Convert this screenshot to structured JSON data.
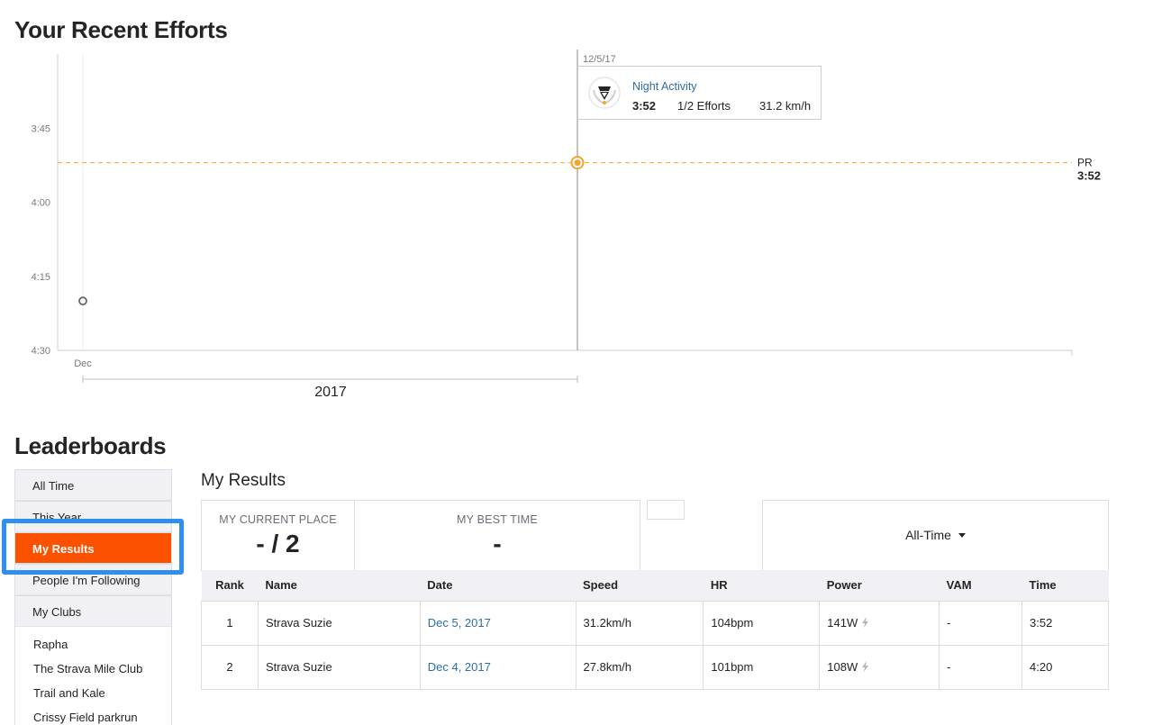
{
  "page": {
    "efforts_heading": "Your Recent Efforts",
    "leaderboards_heading": "Leaderboards"
  },
  "chart_data": {
    "type": "scatter",
    "y_axis": {
      "ticks": [
        "3:45",
        "4:00",
        "4:15",
        "4:30"
      ],
      "range_seconds": [
        210,
        270
      ],
      "reversed": true
    },
    "x_axis": {
      "tick_labels": [
        "Dec"
      ],
      "group_label": "2017"
    },
    "points": [
      {
        "date": "12/4/17",
        "time": "4:20",
        "seconds": 260,
        "highlighted": false
      },
      {
        "date": "12/5/17",
        "time": "3:52",
        "seconds": 232,
        "highlighted": true
      }
    ],
    "pr_line": {
      "label": "PR",
      "time": "3:52",
      "seconds": 232
    },
    "hover_date": "12/5/17",
    "accent_color": "#f2a42b"
  },
  "tooltip": {
    "activity_name": "Night Activity",
    "time": "3:52",
    "efforts": "1/2 Efforts",
    "speed": "31.2 km/h",
    "icon": "trophy-badge-icon"
  },
  "sidebar": {
    "tabs": [
      {
        "label": "All Time",
        "active": false
      },
      {
        "label": "This Year",
        "active": false
      },
      {
        "label": "My Results",
        "active": true
      },
      {
        "label": "People I'm Following",
        "active": false
      },
      {
        "label": "My Clubs",
        "active": false
      }
    ],
    "clubs": [
      "Rapha",
      "The Strava Mile Club",
      "Trail and Kale",
      "Crissy Field parkrun"
    ],
    "active_color": "#fc5200",
    "highlight_color": "#2f8ff0"
  },
  "results": {
    "title": "My Results",
    "current_place_label": "MY CURRENT PLACE",
    "current_place_value": "- / 2",
    "best_time_label": "MY BEST TIME",
    "best_time_value": "-",
    "filter_label": "All-Time",
    "columns": [
      "Rank",
      "Name",
      "Date",
      "Speed",
      "HR",
      "Power",
      "VAM",
      "Time"
    ],
    "rows": [
      {
        "rank": "1",
        "name": "Strava Suzie",
        "date": "Dec 5, 2017",
        "speed": "31.2km/h",
        "hr": "104bpm",
        "power": "141W",
        "vam": "-",
        "time": "3:52"
      },
      {
        "rank": "2",
        "name": "Strava Suzie",
        "date": "Dec 4, 2017",
        "speed": "27.8km/h",
        "hr": "101bpm",
        "power": "108W",
        "vam": "-",
        "time": "4:20"
      }
    ]
  }
}
